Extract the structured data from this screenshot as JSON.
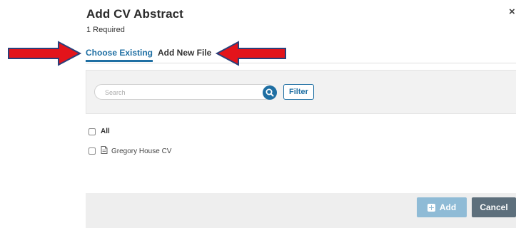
{
  "dialog": {
    "title": "Add CV Abstract",
    "subtitle": "1 Required",
    "close_glyph": "×"
  },
  "tabs": [
    {
      "label": "Choose Existing",
      "active": true
    },
    {
      "label": "Add New File",
      "active": false
    }
  ],
  "search": {
    "placeholder": "Search",
    "value": "",
    "icon": "search-icon"
  },
  "filter_button": {
    "label": "Filter"
  },
  "list": {
    "select_all_label": "All",
    "items": [
      {
        "label": "Gregory House CV",
        "icon": "document-icon",
        "checked": false
      }
    ]
  },
  "footer": {
    "add_label": "Add",
    "cancel_label": "Cancel"
  },
  "annotations": {
    "arrow_color": "#e3141b",
    "arrow_border": "#2a3f7a"
  },
  "colors": {
    "accent": "#1f6fa3",
    "add_button": "#8fbbd6",
    "cancel_button": "#5d6f7c"
  }
}
